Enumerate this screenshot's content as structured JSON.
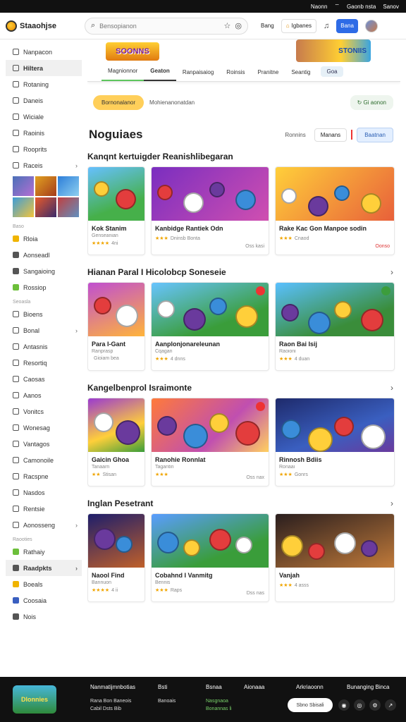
{
  "status_bar": {
    "items": [
      "Naonn",
      "Gaonb nsta",
      "Sanov"
    ]
  },
  "topbar": {
    "logo_text": "Staaohjse",
    "search_placeholder": "Bensopianon",
    "btn_1": "Bang",
    "btn_2": "Igbanes",
    "btn_blue": "Bana"
  },
  "sidebar": {
    "items_top": [
      {
        "label": "Nanpacon",
        "active": false
      },
      {
        "label": "Hiltera",
        "active": true
      },
      {
        "label": "Rotaning",
        "active": false
      },
      {
        "label": "Daneis",
        "active": false
      },
      {
        "label": "Wiciale",
        "active": false
      },
      {
        "label": "Raoinis",
        "active": false
      },
      {
        "label": "Rooprits",
        "active": false
      },
      {
        "label": "Raceis",
        "active": false,
        "chevron": true
      }
    ],
    "section_1": "Baso",
    "items_mid": [
      {
        "label": "Rloia",
        "icon_color": "#f0b400"
      },
      {
        "label": "Aonseadl",
        "icon_color": "#555"
      },
      {
        "label": "Sangaioing",
        "icon_color": "#555"
      },
      {
        "label": "Rossiop",
        "icon_color": "#6cbf3a"
      }
    ],
    "section_2": "Seoasla",
    "items_lower": [
      {
        "label": "Bioens",
        "chevron": false
      },
      {
        "label": "Bonal",
        "chevron": true
      },
      {
        "label": "Antasnis",
        "chevron": false
      },
      {
        "label": "Resortiq",
        "chevron": false
      },
      {
        "label": "Caosas",
        "chevron": false
      },
      {
        "label": "Aanos",
        "chevron": false
      },
      {
        "label": "Vonitcs",
        "chevron": false
      },
      {
        "label": "Wonesag",
        "chevron": false
      },
      {
        "label": "Vantagos",
        "chevron": false
      },
      {
        "label": "Camonoile",
        "chevron": false
      },
      {
        "label": "Racspne",
        "chevron": false
      },
      {
        "label": "Nasdos",
        "chevron": false
      },
      {
        "label": "Rentsie",
        "chevron": false
      },
      {
        "label": "Aonosseng",
        "chevron": true
      }
    ],
    "section_3": "Raooties",
    "items_bottom": [
      {
        "label": "Rathaiy",
        "active": false,
        "icon_color": "#6cbf3a"
      },
      {
        "label": "Raadpkts",
        "active": true,
        "chevron": true,
        "icon_color": "#555"
      },
      {
        "label": "Boeals",
        "active": false,
        "icon_color": "#f0b400"
      },
      {
        "label": "Coosaia",
        "active": false,
        "icon_color": "#3a5fc0"
      },
      {
        "label": "Nois",
        "active": false,
        "icon_color": "#555"
      }
    ]
  },
  "banner": {
    "logo_left": "SOONNS",
    "logo_right": "STONIIS",
    "tabs": [
      {
        "label": "Magnionnor",
        "state": "green"
      },
      {
        "label": "Geaton",
        "state": "active"
      },
      {
        "label": "Ranpaisaiog",
        "state": ""
      },
      {
        "label": "Roinsis",
        "state": ""
      },
      {
        "label": "Pranitne",
        "state": ""
      },
      {
        "label": "Seantig",
        "state": ""
      }
    ],
    "tab_pill": "Goa"
  },
  "filterbar": {
    "pill_yellow": "Bornonalanor",
    "text": "Mohienanonatdan",
    "pill_green": "Gi aonon"
  },
  "header": {
    "title": "Noguiaes",
    "text": "Ronnins",
    "button": "Manans",
    "button_blue": "Baatnan"
  },
  "sections": [
    {
      "title": "Kanqnt kertuigder Reanishlibegaran",
      "show_chevron": false,
      "cards": [
        {
          "title": "Kok Stanim",
          "subtitle": "Genseanian",
          "stars": "★★★★",
          "count": "4ni",
          "right": "",
          "badge": ""
        },
        {
          "title": "Kanbidge Rantiek Odn",
          "subtitle": "",
          "stars": "★★★",
          "count": "Dninsb  Bonta",
          "right": "Oss kasi",
          "badge": ""
        },
        {
          "title": "Rake Kac Gon Manpoe sodin",
          "subtitle": "",
          "stars": "★★★",
          "count": "Cnaod",
          "right": "Oonso",
          "right_red": true,
          "badge": ""
        }
      ]
    },
    {
      "title": "Hianan Paral I Hicolobcp Soneseie",
      "show_chevron": true,
      "cards": [
        {
          "title": "Para I-Gant",
          "subtitle": "Ranprasp",
          "stars": "",
          "count": "Gioiam bea",
          "right": "",
          "badge": ""
        },
        {
          "title": "Aanplonjonareleunan",
          "subtitle": "Cqagan",
          "stars": "★★★",
          "count": "4 dnns",
          "right": "",
          "badge": "◉"
        },
        {
          "title": "Raon Bai Isij",
          "subtitle": "Raoioni",
          "stars": "★★★",
          "count": "4 duan",
          "right": "",
          "badge": "◉",
          "badge_green": true
        }
      ]
    },
    {
      "title": "Kangelbenprol Israimonte",
      "show_chevron": true,
      "cards": [
        {
          "title": "Gaicin Ghoa",
          "subtitle": "Tanaarn",
          "stars": "★★",
          "count": "Stisan",
          "right": "",
          "badge": ""
        },
        {
          "title": "Ranohie Ronnlat",
          "subtitle": "Tagantin",
          "stars": "★★★",
          "count": "",
          "right": "Oss nax",
          "badge": "◉"
        },
        {
          "title": "Rinnosh Bdiis",
          "subtitle": "Ronaai",
          "stars": "★★★",
          "count": "Gonrs",
          "right": "",
          "badge": ""
        }
      ]
    },
    {
      "title": "Inglan Pesetrant",
      "show_chevron": true,
      "cards": [
        {
          "title": "Naool Find",
          "subtitle": "Bannuon",
          "stars": "★★★★",
          "count": "4 ii",
          "right": "",
          "badge": ""
        },
        {
          "title": "Cobahnd I Vanmitg",
          "subtitle": "Bennis",
          "stars": "★★★",
          "count": "Raps",
          "right": "Dss nas",
          "badge": ""
        },
        {
          "title": "Vanjah",
          "subtitle": "",
          "stars": "★★★",
          "count": "4 asss",
          "right": "",
          "badge": ""
        }
      ]
    }
  ],
  "footer": {
    "logo": "Dlonnies",
    "col1": {
      "head": "Nanmatijmnbotias",
      "links": [
        "Rana Bon Baneois",
        "Cabil Dsts Bib"
      ]
    },
    "col2": {
      "head": "Bsti",
      "links": [
        "Banoais"
      ]
    },
    "col3": {
      "head": "Bsnaa",
      "links": [
        "Nasgnaoa",
        "Bonannas li"
      ]
    },
    "col4": {
      "head": "Aionaaa",
      "links": []
    },
    "col5": {
      "head": "Arkriaoonn",
      "links": []
    },
    "col6": {
      "head": "Bunanging Binca",
      "links": []
    },
    "search": "Sbno Sbisali"
  },
  "icons": {
    "search": "search-icon",
    "star": "star-icon",
    "controller": "gamepad-icon",
    "bell": "bell-icon",
    "chevron": "chevron-right-icon"
  }
}
